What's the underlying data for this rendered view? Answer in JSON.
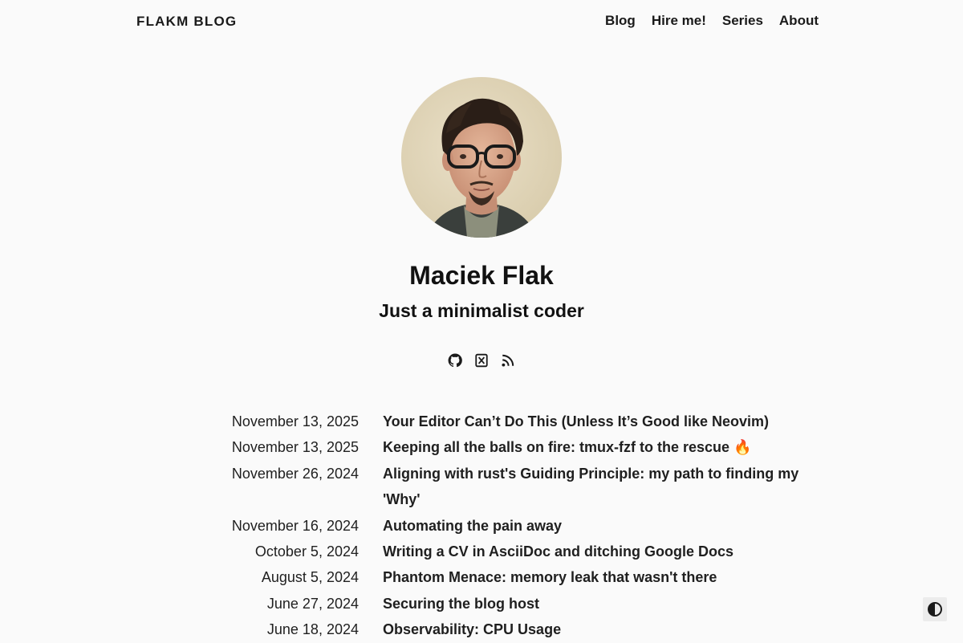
{
  "header": {
    "brand": "FLAKM BLOG",
    "nav": [
      {
        "label": "Blog"
      },
      {
        "label": "Hire me!"
      },
      {
        "label": "Series"
      },
      {
        "label": "About"
      }
    ]
  },
  "profile": {
    "name": "Maciek Flak",
    "tagline": "Just a minimalist coder",
    "social_icons": [
      "github-icon",
      "x-icon",
      "rss-icon"
    ]
  },
  "posts": [
    {
      "date": "November 13, 2025",
      "title": "Your Editor Can’t Do This (Unless It’s Good like Neovim)"
    },
    {
      "date": "November 13, 2025",
      "title": "Keeping all the balls on fire: tmux-fzf to the rescue 🔥"
    },
    {
      "date": "November 26, 2024",
      "title": "Aligning with rust's Guiding Principle: my path to finding my 'Why'"
    },
    {
      "date": "November 16, 2024",
      "title": "Automating the pain away"
    },
    {
      "date": "October 5, 2024",
      "title": "Writing a CV in AsciiDoc and ditching Google Docs"
    },
    {
      "date": "August 5, 2024",
      "title": "Phantom Menace: memory leak that wasn't there"
    },
    {
      "date": "June 27, 2024",
      "title": "Securing the blog host"
    },
    {
      "date": "June 18, 2024",
      "title": "Observability: CPU Usage"
    }
  ],
  "theme_toggle_icon": "contrast-icon",
  "colors": {
    "background": "#fafafa",
    "text": "#111111",
    "toggle_bg": "#ececec"
  }
}
